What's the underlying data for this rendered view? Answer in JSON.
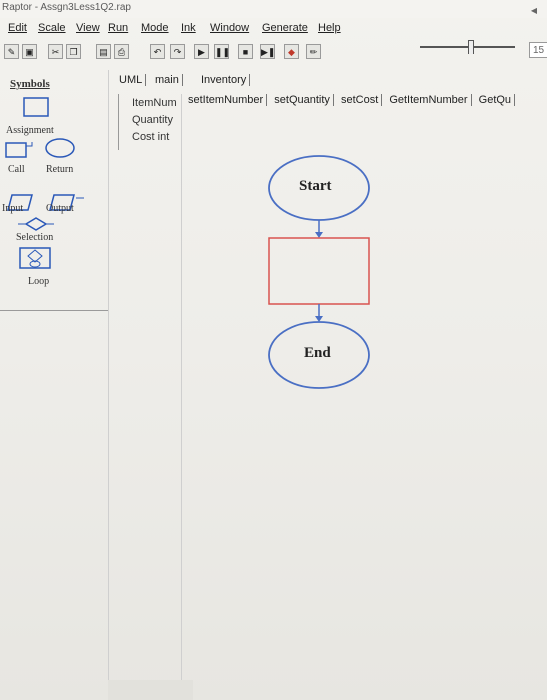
{
  "window": {
    "title": "Raptor - Assgn3Less1Q2.rap"
  },
  "menu": [
    "Edit",
    "Scale",
    "View",
    "Run",
    "Mode",
    "Ink",
    "Window",
    "Generate",
    "Help"
  ],
  "toolbar": {
    "buttons": [
      {
        "name": "open-icon",
        "glyph": "✎"
      },
      {
        "name": "save-icon",
        "glyph": "▣"
      },
      {
        "name": "cut-icon",
        "glyph": "✂"
      },
      {
        "name": "copy-icon",
        "glyph": "❐"
      },
      {
        "name": "paste-icon",
        "glyph": "▤"
      },
      {
        "name": "print-icon",
        "glyph": "⎙"
      },
      {
        "name": "undo-icon",
        "glyph": "↶"
      },
      {
        "name": "redo-icon",
        "glyph": "↷"
      },
      {
        "name": "run-icon",
        "glyph": "▶"
      },
      {
        "name": "pause-icon",
        "glyph": "❚❚"
      },
      {
        "name": "stop-icon",
        "glyph": "■"
      },
      {
        "name": "step-icon",
        "glyph": "▶❚"
      },
      {
        "name": "breakpoint-icon",
        "glyph": "◆"
      },
      {
        "name": "pen-icon",
        "glyph": "✏"
      }
    ],
    "zoom": "15"
  },
  "symbols": {
    "header": "Symbols",
    "assignment": "Assignment",
    "call": "Call",
    "return": "Return",
    "input": "Input",
    "output": "Output",
    "selection": "Selection",
    "loop": "Loop"
  },
  "tabs": [
    "UML",
    "main",
    "Inventory"
  ],
  "variables": [
    "ItemNum",
    "Quantity",
    "Cost int"
  ],
  "method_tabs": [
    "setItemNumber",
    "setQuantity",
    "setCost",
    "GetItemNumber",
    "GetQu"
  ],
  "flowchart": {
    "start": "Start",
    "end": "End"
  },
  "colors": {
    "start_oval": "#4a6fc4",
    "assignment_box": "#d9534f",
    "arrow": "#4a6fc4"
  }
}
